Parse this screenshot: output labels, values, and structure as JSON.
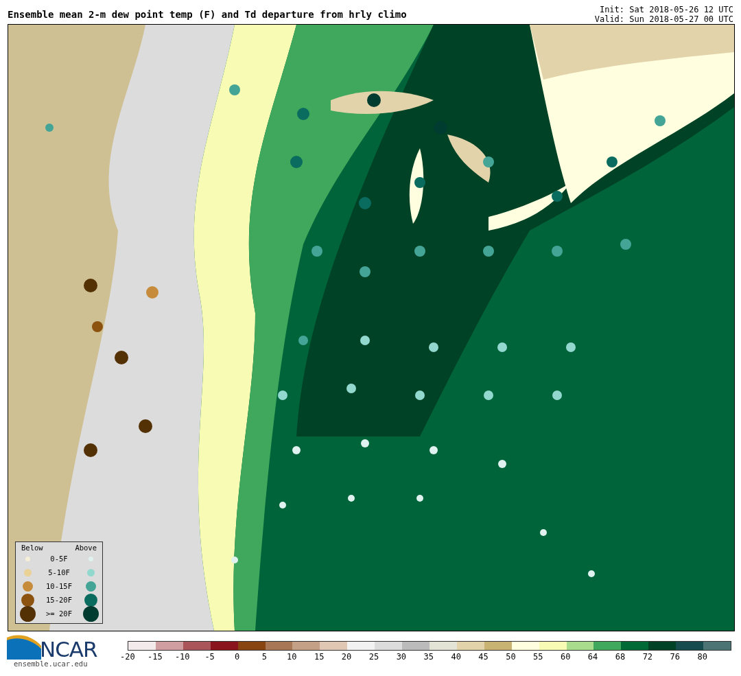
{
  "title": "Ensemble mean 2-m dew point temp (F) and Td departure from hrly climo",
  "run_info": [
    "Init: Sat 2018-05-26 12 UTC",
    "Valid: Sun 2018-05-27 00 UTC"
  ],
  "legend": {
    "headers": [
      "Below",
      "Above"
    ],
    "rows": [
      {
        "label": "0-5F",
        "below": {
          "color": "#f5efd8"
        },
        "above": {
          "color": "#dff2ef"
        }
      },
      {
        "label": "5-10F",
        "below": {
          "color": "#ead196"
        },
        "above": {
          "color": "#92d8cf"
        }
      },
      {
        "label": "10-15F",
        "below": {
          "color": "#c68c3c"
        },
        "above": {
          "color": "#44a597"
        }
      },
      {
        "label": "15-20F",
        "below": {
          "color": "#8c5310"
        },
        "above": {
          "color": "#0a6b5f"
        }
      },
      {
        "label": ">= 20F",
        "below": {
          "color": "#543005"
        },
        "above": {
          "color": "#003c30"
        }
      }
    ]
  },
  "logo": {
    "text": "NCAR",
    "url": "ensemble.ucar.edu"
  },
  "colorbar": {
    "bins": [
      {
        "color": "#f3ebeb"
      },
      {
        "color": "#d09ea1"
      },
      {
        "color": "#aa555a"
      },
      {
        "color": "#8b151c"
      },
      {
        "color": "#894511"
      },
      {
        "color": "#a87755"
      },
      {
        "color": "#c4a087"
      },
      {
        "color": "#dfc7b4"
      },
      {
        "color": "#f2f2f2"
      },
      {
        "color": "#dcdcdc"
      },
      {
        "color": "#bbbbbb"
      },
      {
        "color": "#e3e3d6"
      },
      {
        "color": "#e3d3ab"
      },
      {
        "color": "#c9b373"
      },
      {
        "color": "#ffffe0"
      },
      {
        "color": "#f8fbb4"
      },
      {
        "color": "#a9dc8c"
      },
      {
        "color": "#3fa85c"
      },
      {
        "color": "#006a37"
      },
      {
        "color": "#004225"
      },
      {
        "color": "#174c4f"
      },
      {
        "color": "#4c7474"
      }
    ],
    "ticks": [
      "-20",
      "-15",
      "-10",
      "-5",
      "0",
      "5",
      "10",
      "15",
      "20",
      "25",
      "30",
      "35",
      "40",
      "45",
      "50",
      "55",
      "60",
      "64",
      "68",
      "72",
      "76",
      "80"
    ]
  }
}
